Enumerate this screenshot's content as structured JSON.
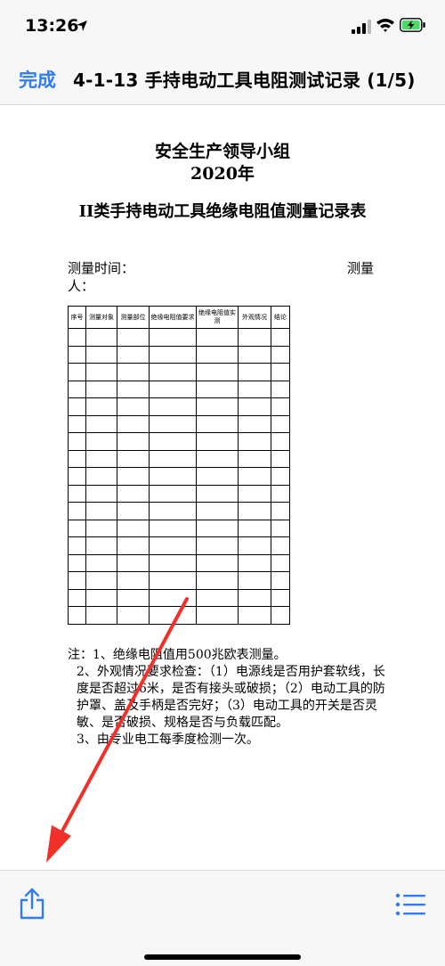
{
  "status_bar": {
    "time": "13:26"
  },
  "nav": {
    "done_label": "完成",
    "title": "4-1-13 手持电动工具电阻测试记录 (1/5)"
  },
  "document": {
    "org": "安全生产领导小组",
    "year": "2020年",
    "title": "II类手持电动工具绝缘电阻值测量记录表",
    "measure_time_label": "测量时间：",
    "measurer_label_part1": "测量",
    "measurer_label_part2": "人：",
    "table": {
      "headers": [
        "序号",
        "测量对象",
        "测量部位",
        "绝缘电阻值要求",
        "绝缘电阻值实测",
        "外观情况",
        "结论"
      ],
      "empty_rows": 17
    },
    "notes": [
      "注：1、绝缘电阻值用500兆欧表测量。",
      "2、外观情况要求检查：（1）电源线是否用护套软线，长度是否超过6米，是否有接头或破损；（2）电动工具的防护罩、盖及手柄是否完好；（3）电动工具的开关是否灵敏、是否破损、规格是否与负载匹配。",
      "3、由专业电工每季度检测一次。"
    ]
  },
  "colors": {
    "accent": "#2f7cf6",
    "arrow": "#f0312a",
    "battery_fill": "#4cd964"
  },
  "icons": {
    "share": "share-icon",
    "list": "list-icon"
  }
}
